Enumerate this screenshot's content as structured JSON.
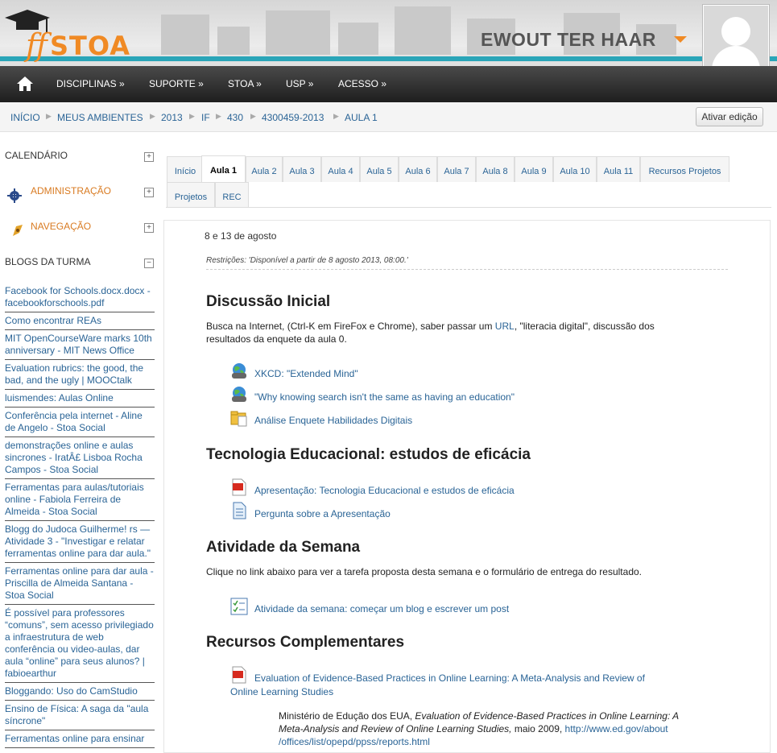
{
  "header": {
    "logo_text": "STOA",
    "username": "EWOUT TER HAAR"
  },
  "nav": {
    "items": [
      "DISCIPLINAS »",
      "SUPORTE »",
      "STOA »",
      "USP »",
      "ACESSO »"
    ]
  },
  "breadcrumb": {
    "items": [
      "INÍCIO",
      "MEUS AMBIENTES",
      "2013",
      "IF",
      "430",
      "4300459-2013",
      "AULA 1"
    ],
    "edit_button": "Ativar edição"
  },
  "sidebar": {
    "calendar": "CALENDÁRIO",
    "admin": "ADMINISTRAÇÃO",
    "navigation": "NAVEGAÇÃO",
    "blogs_title": "BLOGS DA TURMA",
    "blogs": [
      "Facebook for Schools.docx.docx - facebookforschools.pdf",
      "Como encontrar REAs",
      "MIT OpenCourseWare marks 10th anniversary - MIT News Office",
      "Evaluation rubrics: the good, the bad, and the ugly | MOOCtalk",
      "luismendes: Aulas Online",
      "Conferência pela internet - Aline de Angelo - Stoa Social",
      "demonstrações online e aulas sincrones - IratÂ£ Lisboa Rocha Campos - Stoa Social",
      "Ferramentas para aulas/tutoriais online - Fabiola Ferreira de Almeida - Stoa Social",
      "Blogg do Judoca Guilherme! rs — Atividade 3 - \"Investigar e relatar ferramentas online para dar aula.\"",
      "Ferramentas online para dar aula - Priscilla de Almeida Santana - Stoa Social",
      "É possível para professores “comuns”, sem acesso privilegiado a infraestrutura de web conferência ou video-aulas, dar aula “online” para seus alunos? | fabioearthur",
      "Bloggando: Uso do CamStudio",
      "Ensino de Física: A saga da \"aula síncrone\"",
      "Ferramentas online para ensinar"
    ]
  },
  "tabs": {
    "row1": [
      "Início",
      "Aula 1",
      "Aula 2",
      "Aula 3",
      "Aula 4",
      "Aula 5",
      "Aula 6",
      "Aula 7",
      "Aula 8",
      "Aula 9",
      "Aula 10",
      "Aula 11",
      "Recursos Projetos"
    ],
    "row2": [
      "Projetos",
      "REC"
    ],
    "active": "Aula 1"
  },
  "content": {
    "date": "8 e 13 de agosto",
    "restriction": "Restrições: 'Disponível a partir de 8 agosto 2013, 08:00.'",
    "sec1_title": "Discussão Inicial",
    "sec1_text_a": "Busca na Internet, (Ctrl-K em FireFox e Chrome), saber passar um ",
    "sec1_link": "URL",
    "sec1_text_b": ", \"literacia digital\", discussão dos",
    "sec1_text_c": "resultados da enquete da aula 0.",
    "sec1_resources": [
      "XKCD: \"Extended Mind\"",
      "\"Why knowing search isn't the same as having an education\"",
      "Análise Enquete Habilidades Digitais"
    ],
    "sec2_title": "Tecnologia Educacional: estudos de eficácia",
    "sec2_resources": [
      "Apresentação: Tecnologia Educacional e estudos de eficácia",
      "Pergunta sobre a Apresentação"
    ],
    "sec3_title": "Atividade da Semana",
    "sec3_text": "Clique no link abaixo para ver a tarefa proposta desta semana e o formulário de entrega do resultado.",
    "sec3_resource": "Atividade da semana: começar um blog e escrever um post",
    "sec4_title": "Recursos Complementares",
    "sec4_resource_a": "Evaluation of Evidence-Based Practices in Online Learning: A Meta-Analysis and Review of",
    "sec4_resource_b": "Online Learning Studies",
    "ref_a": "Ministério de Edução dos EUA, ",
    "ref_title_a": "Evaluation of Evidence-Based Practices in Online Learning: A",
    "ref_title_b": "Meta-Analysis and Review of Online Learning Studies,",
    "ref_b": " maio 2009, ",
    "ref_link_a": "http://www.ed.gov/about",
    "ref_link_b": "/offices/list/opepd/ppss/reports.html"
  }
}
